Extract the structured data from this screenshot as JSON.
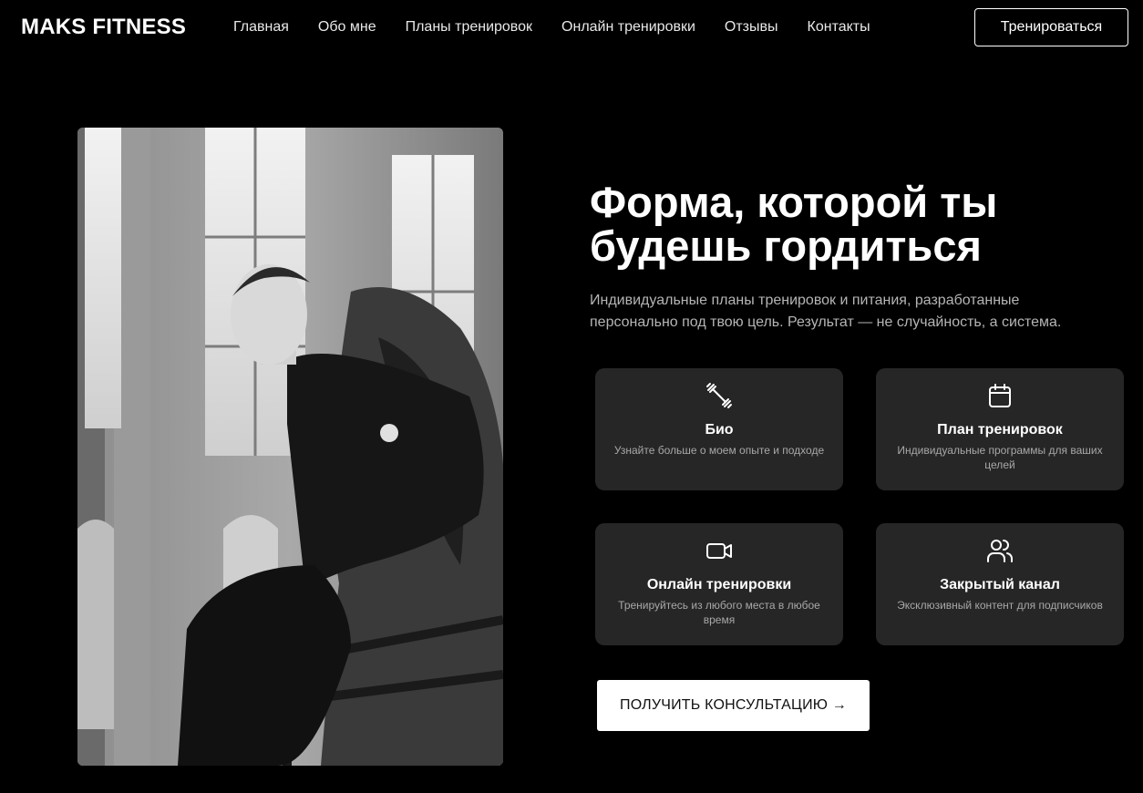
{
  "header": {
    "logo": "MAKS FITNESS",
    "nav": [
      "Главная",
      "Обо мне",
      "Планы тренировок",
      "Онлайн тренировки",
      "Отзывы",
      "Контакты"
    ],
    "cta": "Тренироваться"
  },
  "hero": {
    "title": "Форма, которой ты будешь гордиться",
    "subtitle": "Индивидуальные планы тренировок и питания, разработанные персонально под твою цель. Результат — не случайность, а система.",
    "cta": "ПОЛУЧИТЬ КОНСУЛЬТАЦИЮ →"
  },
  "cards": [
    {
      "icon": "dumbbell-icon",
      "title": "Био",
      "desc": "Узнайте больше о моем опыте и подходе"
    },
    {
      "icon": "calendar-icon",
      "title": "План тренировок",
      "desc": "Индивидуальные программы для ваших целей"
    },
    {
      "icon": "video-icon",
      "title": "Онлайн тренировки",
      "desc": "Тренируйтесь из любого места в любое время"
    },
    {
      "icon": "users-icon",
      "title": "Закрытый канал",
      "desc": "Эксклюзивный контент для подписчиков"
    }
  ],
  "photo": {
    "icon": "trainer-photo"
  }
}
